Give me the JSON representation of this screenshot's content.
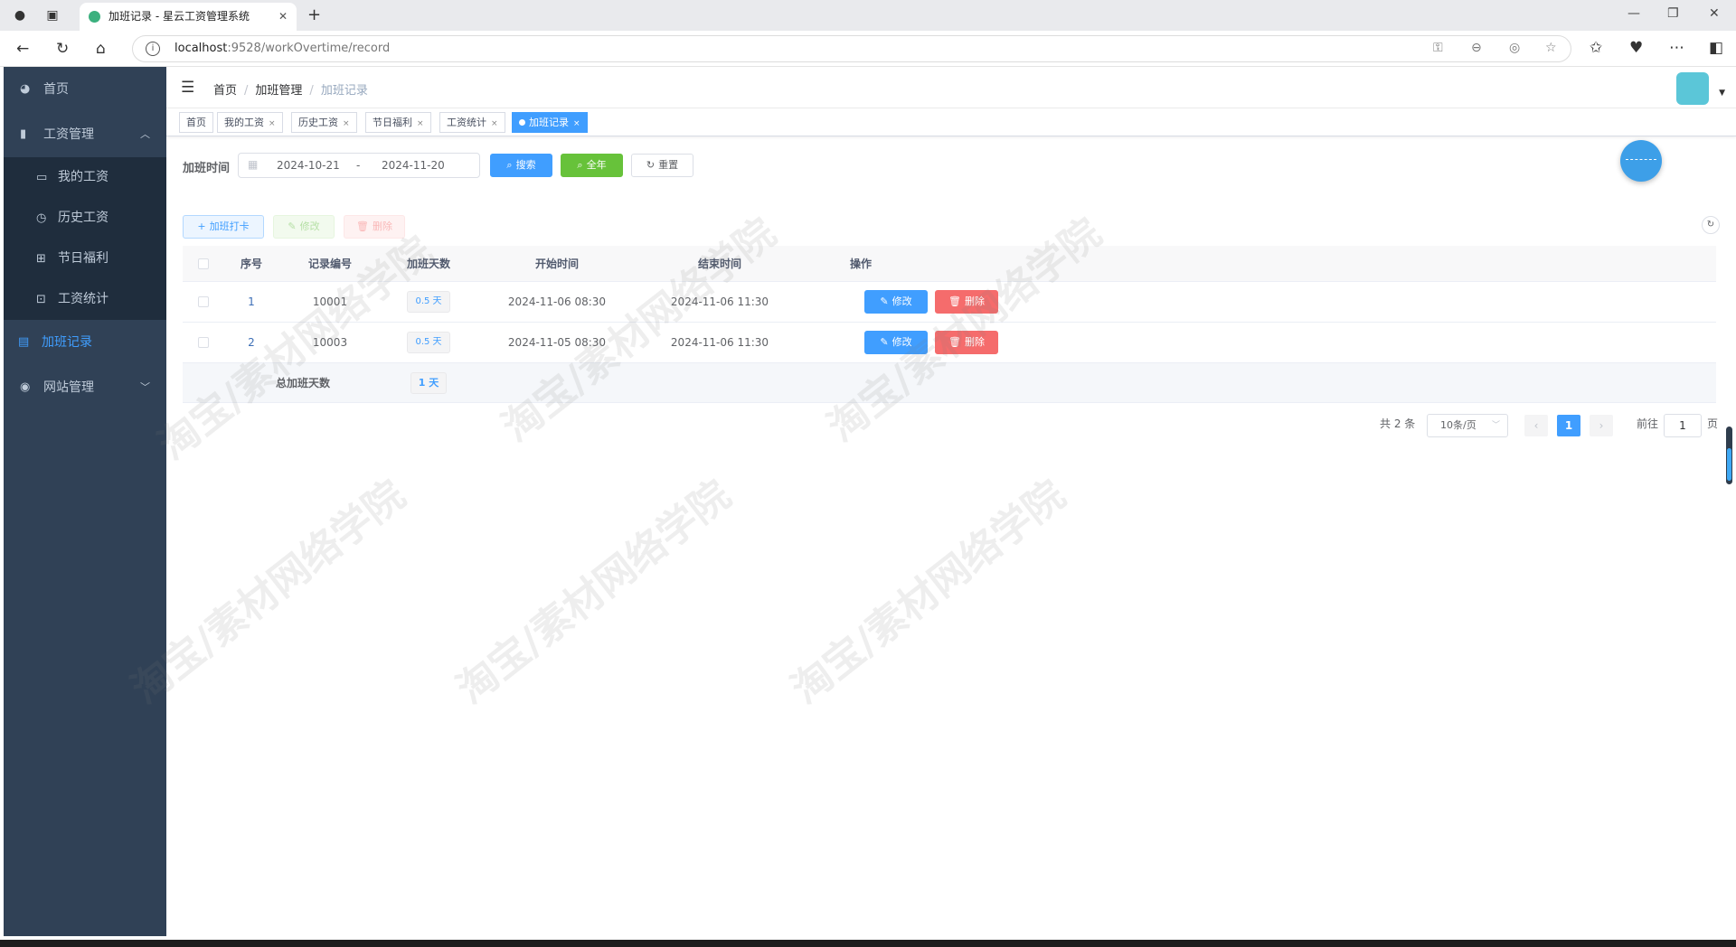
{
  "browser": {
    "tab_title": "加班记录 - 星云工资管理系统",
    "url_host": "localhost",
    "url_path": ":9528/workOvertime/record"
  },
  "sidebar": {
    "items": [
      {
        "label": "首页"
      },
      {
        "label": "工资管理"
      },
      {
        "label": "我的工资"
      },
      {
        "label": "历史工资"
      },
      {
        "label": "节日福利"
      },
      {
        "label": "工资统计"
      },
      {
        "label": "加班记录"
      },
      {
        "label": "网站管理"
      }
    ]
  },
  "breadcrumb": [
    "首页",
    "加班管理",
    "加班记录"
  ],
  "tags": [
    "首页",
    "我的工资",
    "历史工资",
    "节日福利",
    "工资统计",
    "加班记录"
  ],
  "filter": {
    "label": "加班时间",
    "start": "2024-10-21",
    "separator": "-",
    "end": "2024-11-20",
    "search_label": "搜索",
    "year_label": "全年",
    "reset_label": "重置"
  },
  "toolbar": {
    "add_label": "加班打卡",
    "edit_label": "修改",
    "delete_label": "删除"
  },
  "table": {
    "headers": [
      "序号",
      "记录编号",
      "加班天数",
      "开始时间",
      "结束时间",
      "操作"
    ],
    "rows": [
      {
        "index": "1",
        "id": "10001",
        "days": "0.5 天",
        "start": "2024-11-06 08:30",
        "end": "2024-11-06 11:30"
      },
      {
        "index": "2",
        "id": "10003",
        "days": "0.5 天",
        "start": "2024-11-05 08:30",
        "end": "2024-11-06 11:30"
      }
    ],
    "row_edit": "修改",
    "row_delete": "删除",
    "sum_label": "总加班天数",
    "sum_value": "1 天"
  },
  "pagination": {
    "total": "共 2 条",
    "page_size": "10条/页",
    "current": "1",
    "goto_label": "前往",
    "goto_value": "1",
    "page_unit": "页"
  },
  "watermark": "淘宝/素材网络学院",
  "colors": {
    "sidebar": "#304156",
    "primary": "#409eff",
    "success": "#67c23a",
    "danger": "#f56c6c"
  }
}
